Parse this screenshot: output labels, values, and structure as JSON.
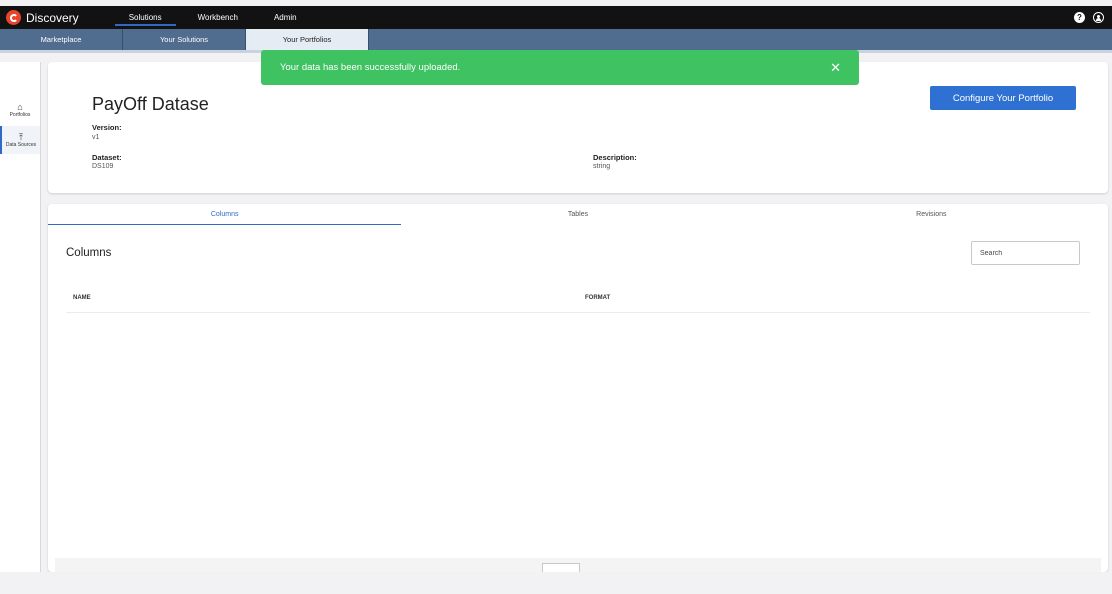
{
  "app": {
    "brand": "Discovery"
  },
  "topnav": [
    {
      "label": "Solutions",
      "active": true
    },
    {
      "label": "Workbench",
      "active": false
    },
    {
      "label": "Admin",
      "active": false
    }
  ],
  "topbar_right": {
    "help_glyph": "?",
    "help_icon": "help-icon",
    "user_icon": "user-icon"
  },
  "subnav": [
    {
      "label": "Marketplace",
      "active": false
    },
    {
      "label": "Your Solutions",
      "active": false
    },
    {
      "label": "Your Portfolios",
      "active": true
    }
  ],
  "rail": [
    {
      "label": "Portfolios",
      "icon": "home-icon",
      "glyph": "⌂"
    },
    {
      "label": "Data Sources",
      "icon": "upload-icon",
      "glyph": "⤒"
    }
  ],
  "toast": {
    "message": "Your data has been successfully uploaded.",
    "close_glyph": "✕",
    "color": "#3ec262"
  },
  "dataset": {
    "title": "PayOff Datase",
    "version_label": "Version:",
    "version_value": "v1",
    "dataset_label": "Dataset:",
    "dataset_value": "DS109",
    "description_label": "Description:",
    "description_value": "string"
  },
  "configure_button": {
    "label": "Configure Your Portfolio",
    "color": "#2f71d2"
  },
  "tabs": [
    {
      "label": "Columns",
      "active": true
    },
    {
      "label": "Tables",
      "active": false
    },
    {
      "label": "Revisions",
      "active": false
    }
  ],
  "columns_section": {
    "title": "Columns",
    "search_placeholder": "Search",
    "headers": [
      "NAME",
      "FORMAT"
    ]
  },
  "colors": {
    "accent": "#2f6bc4",
    "topbar": "#121212",
    "subnav": "#506d8f"
  }
}
